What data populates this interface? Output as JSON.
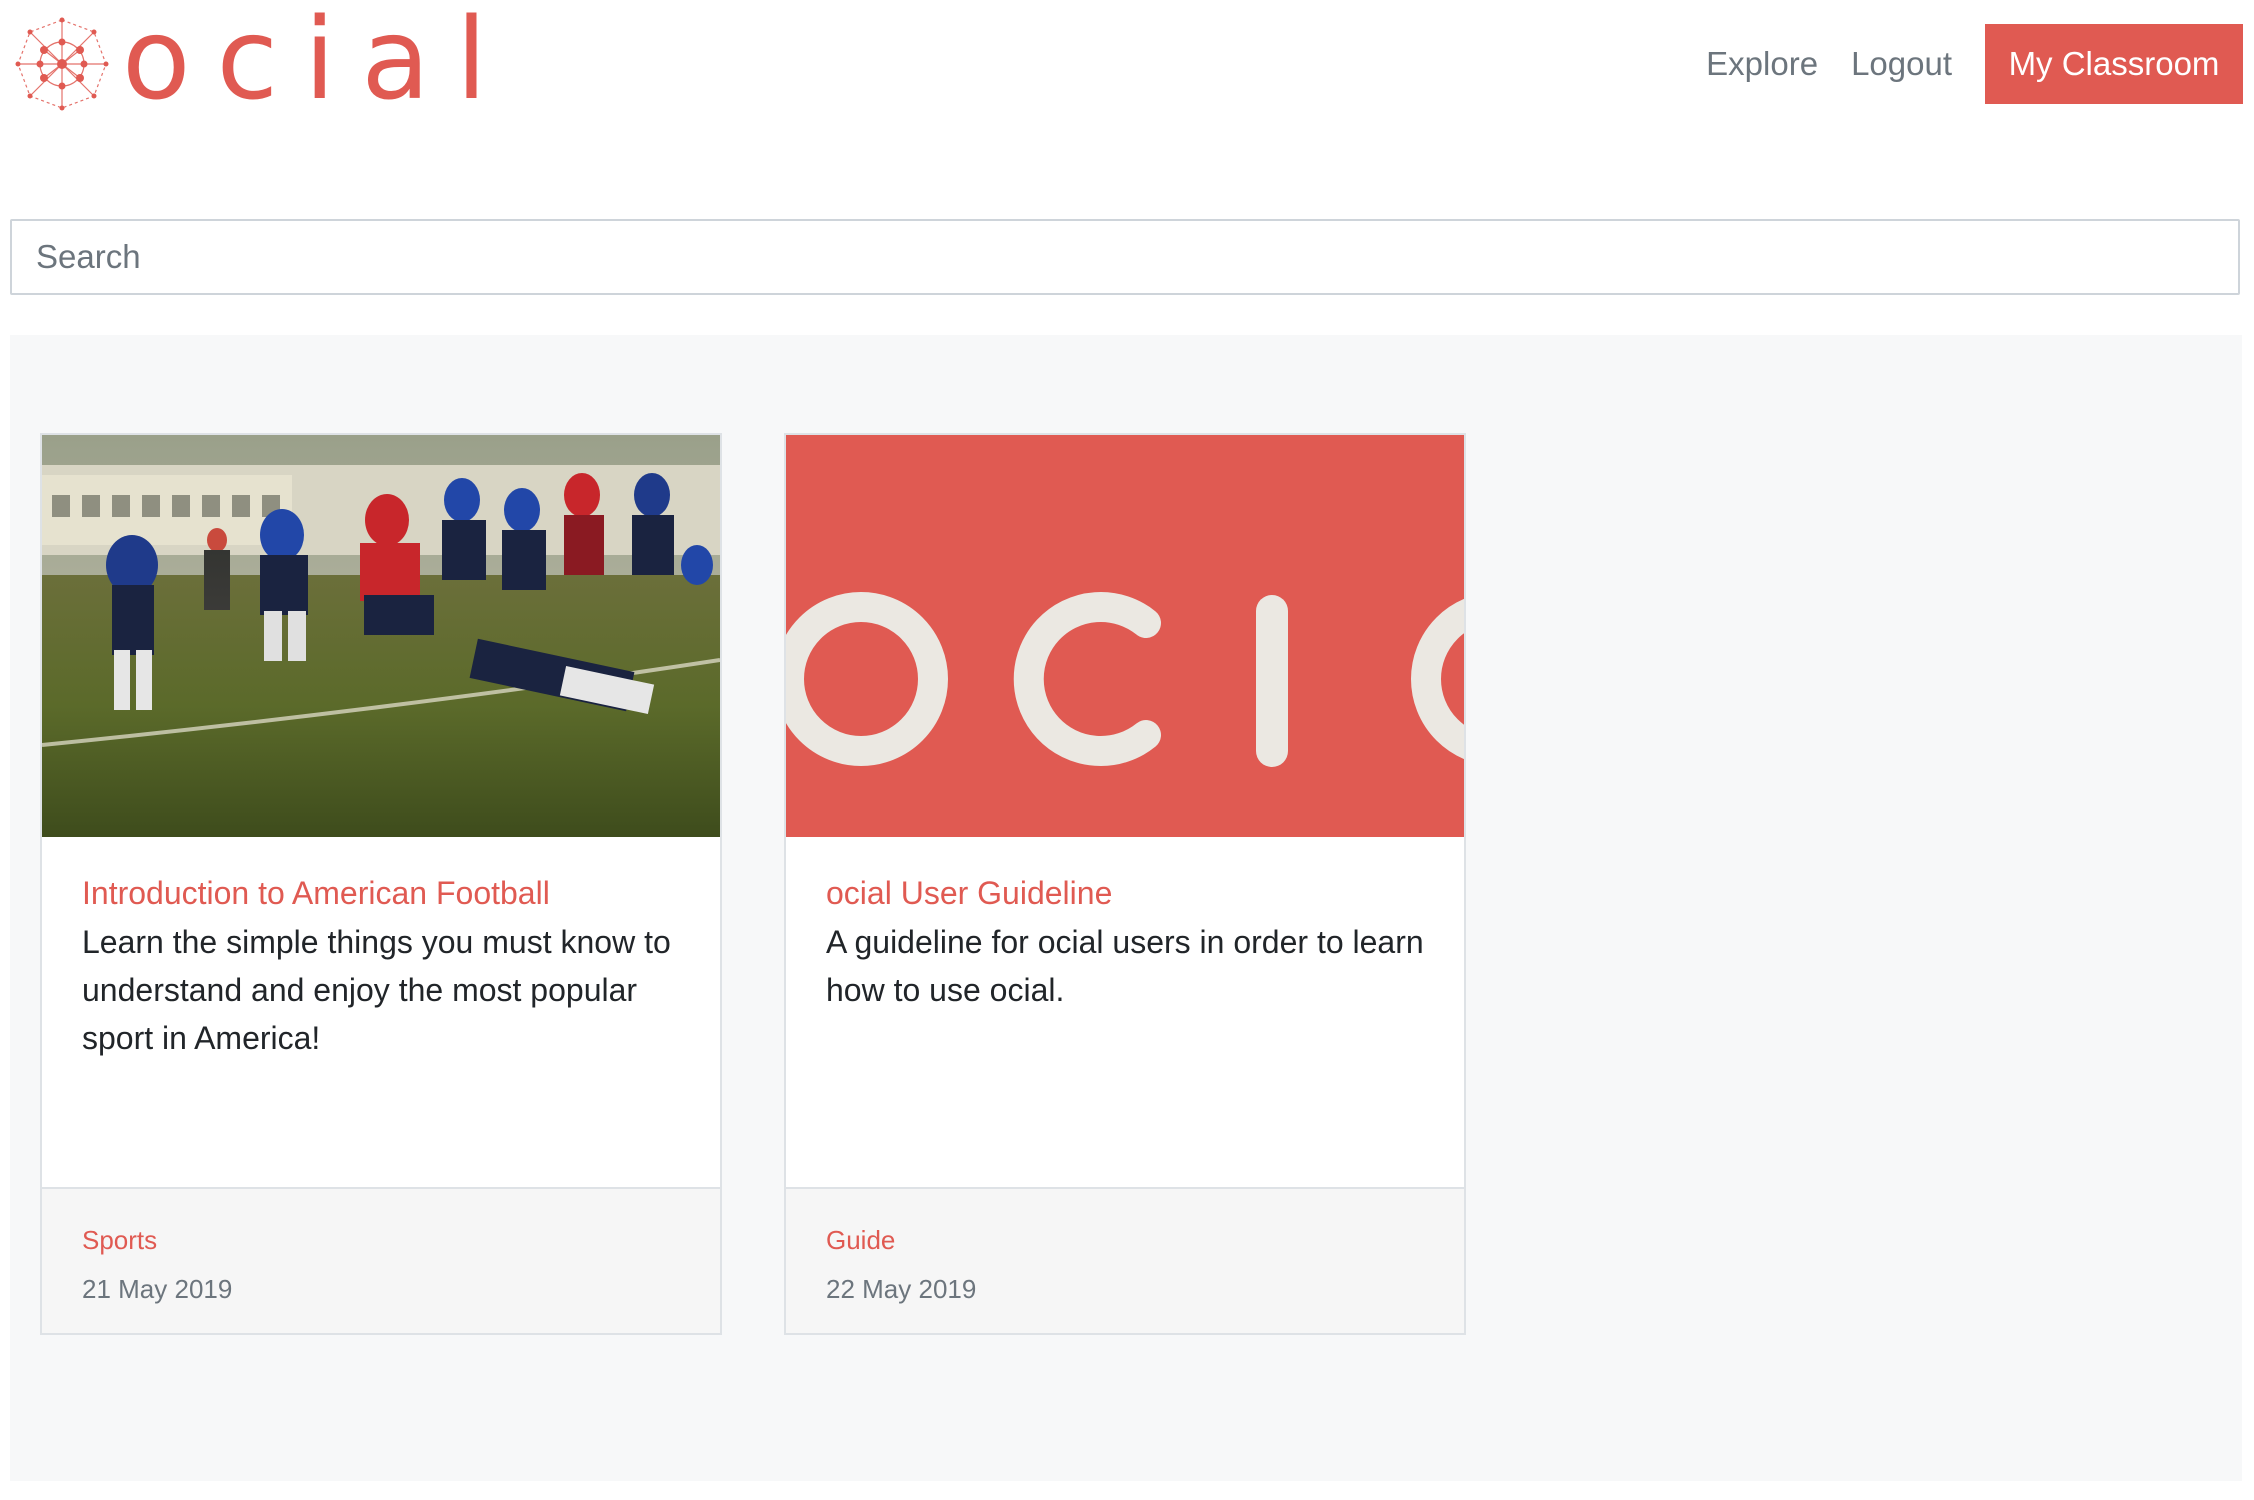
{
  "header": {
    "logo_text": "ocial",
    "nav": {
      "explore": "Explore",
      "logout": "Logout",
      "my_classroom": "My Classroom"
    }
  },
  "search": {
    "placeholder": "Search",
    "value": ""
  },
  "courses": [
    {
      "title": "Introduction to American Football",
      "description": "Learn the simple things you must know to understand and enjoy the most popular sport in America!",
      "category": "Sports",
      "date": "21 May 2019",
      "image": "american-football-photo"
    },
    {
      "title": "ocial User Guideline",
      "description": "A guideline for ocial users in order to learn how to use ocial.",
      "category": "Guide",
      "date": "22 May 2019",
      "image": "ocial-logo-banner"
    }
  ],
  "colors": {
    "accent": "#e05a52",
    "muted": "#6c757d",
    "banner_text": "#ebe8e2",
    "page_bg": "#f7f8f9"
  }
}
